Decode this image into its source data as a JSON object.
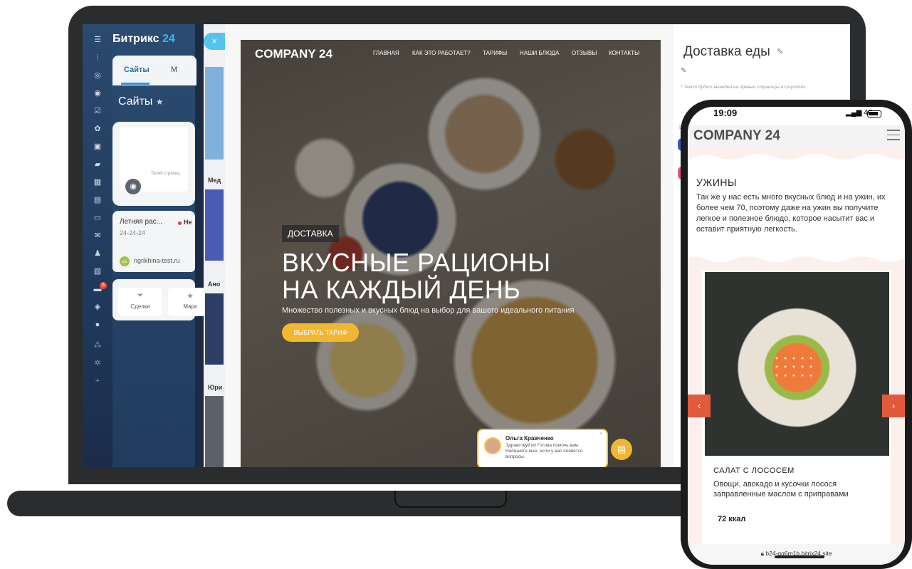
{
  "bitrix": {
    "logo_text": "Битрикс",
    "logo_number": "24",
    "tab_active": "Сайты",
    "tab_other": "М",
    "page_title": "Сайты",
    "card_text": "Твоей страниц",
    "site_name": "Летняя рас...",
    "site_date": "24-24-24",
    "site_status": "Не",
    "domain": "ngrikhina-test.ru",
    "notification_count": "5",
    "action_deals": "Сделки",
    "action_market": "Марк"
  },
  "mid_panel": {
    "label_1": "Мед",
    "label_2": "Ано",
    "label_3": "Юри"
  },
  "landing": {
    "logo": "COMPANY 24",
    "nav": [
      "ГЛАВНАЯ",
      "КАК ЭТО РАБОТАЕТ?",
      "ТАРИФЫ",
      "НАШИ БЛЮДА",
      "ОТЗЫВЫ",
      "КОНТАКТЫ"
    ],
    "tag": "ДОСТАВКА",
    "title_line1": "ВКУСНЫЕ РАЦИОНЫ",
    "title_line2": "НА КАЖДЫЙ ДЕНЬ",
    "subtitle": "Множество полезных и вкусных блюд на выбор для вашего идеального питания",
    "cta": "ВЫБРАТЬ ТАРИФ"
  },
  "chat": {
    "name": "Ольга Кравченко",
    "text": "Здравствуйте! Готова помочь вам. Напишите мне, если у вас появятся вопросы."
  },
  "settings": {
    "title": "Доставка еды",
    "hint": "* Текст будет выведен на превью страницы в соцсетях",
    "label": "Ц"
  },
  "phone": {
    "time": "19:09",
    "network": "4G",
    "logo": "COMPANY 24",
    "section_title": "УЖИНЫ",
    "section_text": "Так же у нас есть много вкусных блюд и на ужин, их более чем 70, поэтому даже на ужин вы получите легкое и полезное блюдо, которое насытит вас и оставит приятную легкость.",
    "item_title": "САЛАТ С ЛОСОСЕМ",
    "item_desc": "Овощи, авокадо и кусочки лосося заправленные маслом с приправами",
    "kcal": "72 ккал",
    "url": "b24-qg6m1b.bitrix24.site"
  },
  "colors": {
    "accent_yellow": "#f2b731",
    "bitrix_blue": "#2b4b70",
    "arrow_red": "#e15a3c"
  }
}
